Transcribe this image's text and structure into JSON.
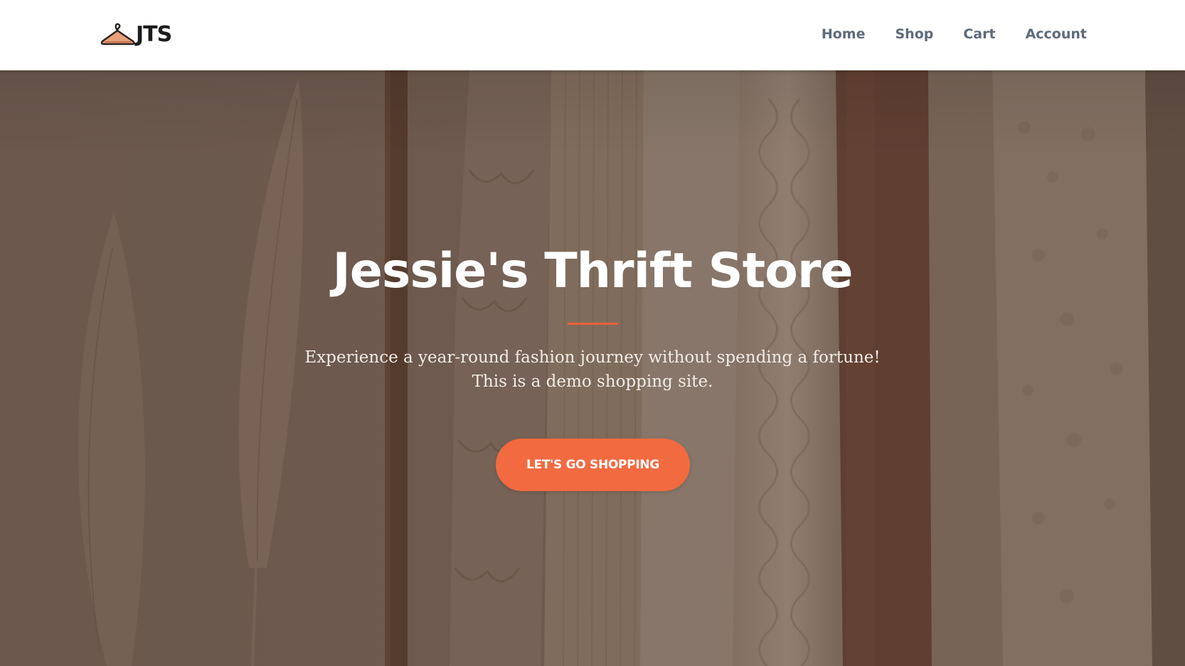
{
  "brand": {
    "logo_text": "JTS",
    "logo_icon": "hanger-icon",
    "accent_color": "#f26a40"
  },
  "nav": {
    "items": [
      {
        "label": "Home"
      },
      {
        "label": "Shop"
      },
      {
        "label": "Cart"
      },
      {
        "label": "Account"
      }
    ]
  },
  "hero": {
    "title": "Jessie's Thrift Store",
    "subtitle_line1": "Experience a year-round fashion journey without spending a fortune!",
    "subtitle_line2": "This is a demo shopping site.",
    "cta_label": "LET'S GO SHOPPING",
    "background": "clothes-rack-with-pampas-grass-image"
  }
}
